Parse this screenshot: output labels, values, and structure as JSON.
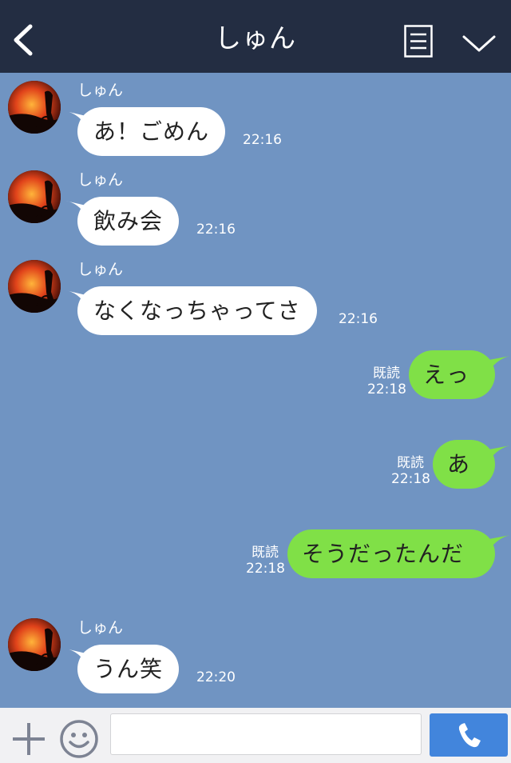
{
  "header": {
    "title": "しゅん"
  },
  "icons": {
    "back": "chevron-left-icon",
    "menu": "document-menu-icon",
    "collapse": "chevron-down-icon",
    "add": "plus-icon",
    "emoji": "smiley-icon",
    "call": "phone-icon"
  },
  "colors": {
    "header_bg": "#232d42",
    "chat_bg": "#7094c2",
    "bubble_in": "#ffffff",
    "bubble_out": "#80e047",
    "call_button": "#4285dc"
  },
  "messages": [
    {
      "direction": "in",
      "sender": "しゅん",
      "text": "あ！ごめん",
      "time": "22:16"
    },
    {
      "direction": "in",
      "sender": "しゅん",
      "text": "飲み会",
      "time": "22:16"
    },
    {
      "direction": "in",
      "sender": "しゅん",
      "text": "なくなっちゃってさ",
      "time": "22:16"
    },
    {
      "direction": "out",
      "read": "既読",
      "text": "えっ",
      "time": "22:18"
    },
    {
      "direction": "out",
      "read": "既読",
      "text": "あ",
      "time": "22:18"
    },
    {
      "direction": "out",
      "read": "既読",
      "text": "そうだったんだ",
      "time": "22:18"
    },
    {
      "direction": "in",
      "sender": "しゅん",
      "text": "うん笑",
      "time": "22:20"
    }
  ],
  "input": {
    "value": "",
    "placeholder": ""
  }
}
